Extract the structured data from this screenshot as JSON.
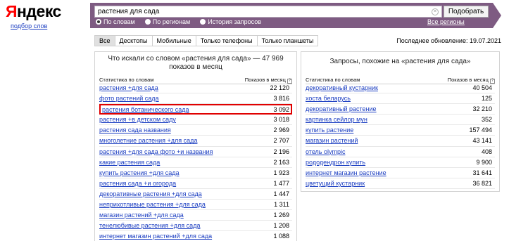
{
  "logo": {
    "first": "Я",
    "rest": "ндекс"
  },
  "subtitle": "подбор слов",
  "search": {
    "query": "растения для сада",
    "button": "Подобрать",
    "clear": "×"
  },
  "modes": [
    {
      "label": "По словам",
      "checked": true
    },
    {
      "label": "По регионам",
      "checked": false
    },
    {
      "label": "История запросов",
      "checked": false
    }
  ],
  "regions_link": "Все регионы",
  "tabs": [
    "Все",
    "Десктопы",
    "Мобильные",
    "Только телефоны",
    "Только планшеты"
  ],
  "active_tab": 0,
  "last_update": "Последнее обновление: 19.07.2021",
  "left": {
    "title": "Что искали со словом «растения для сада» — 47 969 показов в месяц",
    "col_word": "Статистика по словам",
    "col_count": "Показов в месяц",
    "help": "?",
    "rows": [
      {
        "kw": "растения +для сада",
        "cnt": "22 120"
      },
      {
        "kw": "фото растений сада",
        "cnt": "3 816"
      },
      {
        "kw": "растения ботанического сада",
        "cnt": "3 092",
        "highlight": true
      },
      {
        "kw": "растения +в детском саду",
        "cnt": "3 018"
      },
      {
        "kw": "растения сада названия",
        "cnt": "2 969"
      },
      {
        "kw": "многолетние растения +для сада",
        "cnt": "2 707"
      },
      {
        "kw": "растения +для сада фото +и названия",
        "cnt": "2 196"
      },
      {
        "kw": "какие растения сада",
        "cnt": "2 163"
      },
      {
        "kw": "купить растения +для сада",
        "cnt": "1 923"
      },
      {
        "kw": "растения сада +и огорода",
        "cnt": "1 477"
      },
      {
        "kw": "декоративные растения +для сада",
        "cnt": "1 447"
      },
      {
        "kw": "неприхотливые растения +для сада",
        "cnt": "1 311"
      },
      {
        "kw": "магазин растений +для сада",
        "cnt": "1 269"
      },
      {
        "kw": "тенелюбивые растения +для сада",
        "cnt": "1 208"
      },
      {
        "kw": "интернет магазин растений +для сада",
        "cnt": "1 088"
      }
    ]
  },
  "right": {
    "title": "Запросы, похожие на «растения для сада»",
    "col_word": "Статистика по словам",
    "col_count": "Показов в месяц",
    "help": "?",
    "rows": [
      {
        "kw": "декоративный кустарник",
        "cnt": "40 504"
      },
      {
        "kw": "хоста беларусь",
        "cnt": "125"
      },
      {
        "kw": "декоративный растение",
        "cnt": "32 210"
      },
      {
        "kw": "картинка сейлор мун",
        "cnt": "352"
      },
      {
        "kw": "купить растение",
        "cnt": "157 494"
      },
      {
        "kw": "магазин растений",
        "cnt": "43 141"
      },
      {
        "kw": "отель olympic",
        "cnt": "408"
      },
      {
        "kw": "рододендрон купить",
        "cnt": "9 900"
      },
      {
        "kw": "интернет магазин растение",
        "cnt": "31 641"
      },
      {
        "kw": "цветущий кустарник",
        "cnt": "36 821"
      }
    ]
  }
}
